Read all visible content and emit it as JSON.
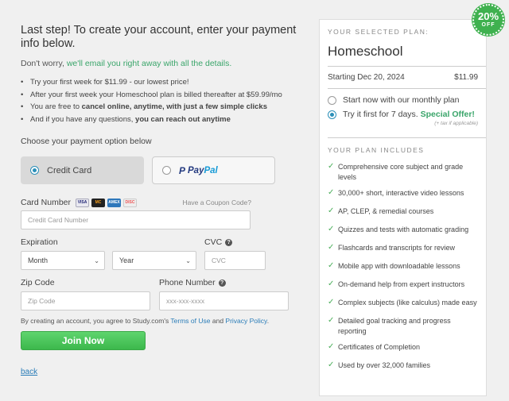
{
  "heading": "Last step! To create your account, enter your payment info below.",
  "dont_worry_prefix": "Don't worry, ",
  "dont_worry_green": "we'll email you right away with all the details.",
  "bullets": [
    {
      "pre": "Try your first week for $11.99 - our lowest price!",
      "bold": "",
      "post": ""
    },
    {
      "pre": "After your first week your Homeschool plan is billed thereafter at $59.99/mo",
      "bold": "",
      "post": ""
    },
    {
      "pre": "You are free to ",
      "bold": "cancel online, anytime, with just a few simple clicks",
      "post": ""
    },
    {
      "pre": "And if you have any questions, ",
      "bold": "you can reach out anytime",
      "post": ""
    }
  ],
  "choose_label": "Choose your payment option below",
  "payment_options": {
    "credit_card": "Credit Card",
    "paypal_pay": "Pay",
    "paypal_pal": "Pal"
  },
  "card_number": {
    "label": "Card Number",
    "placeholder": "Credit Card Number",
    "coupon": "Have a Coupon Code?",
    "brands": [
      "VISA",
      "MC",
      "AMEX",
      "DISC"
    ]
  },
  "expiration": {
    "label": "Expiration",
    "month": "Month",
    "year": "Year"
  },
  "cvc": {
    "label": "CVC",
    "placeholder": "CVC"
  },
  "zip": {
    "label": "Zip Code",
    "placeholder": "Zip Code"
  },
  "phone": {
    "label": "Phone Number",
    "placeholder": "xxx-xxx-xxxx"
  },
  "agree": {
    "pre": "By creating an account, you agree to Study.com's ",
    "terms": "Terms of Use",
    "and": " and ",
    "privacy": "Privacy Policy",
    "post": "."
  },
  "join_label": "Join Now",
  "back_label": "back",
  "badge": {
    "pct": "20%",
    "off": "OFF"
  },
  "plan": {
    "selected_header": "YOUR SELECTED PLAN:",
    "name": "Homeschool",
    "starting": "Starting Dec 20, 2024",
    "price": "$11.99",
    "opt_monthly": "Start now with our monthly plan",
    "opt_trial": "Try it first for 7 days.",
    "special": "Special Offer!",
    "tax": "(+ tax if applicable)",
    "includes_header": "YOUR PLAN INCLUDES",
    "features": [
      "Comprehensive core subject and grade levels",
      "30,000+ short, interactive video lessons",
      "AP, CLEP, & remedial courses",
      "Quizzes and tests with automatic grading",
      "Flashcards and transcripts for review",
      "Mobile app with downloadable lessons",
      "On-demand help from expert instructors",
      "Complex subjects (like calculus) made easy",
      "Detailed goal tracking and progress reporting",
      "Certificates of Completion",
      "Used by over 32,000 families"
    ]
  },
  "colors": {
    "accent_green": "#3aa56a",
    "link_blue": "#2b7db8",
    "radio_blue": "#2b8fb8"
  }
}
